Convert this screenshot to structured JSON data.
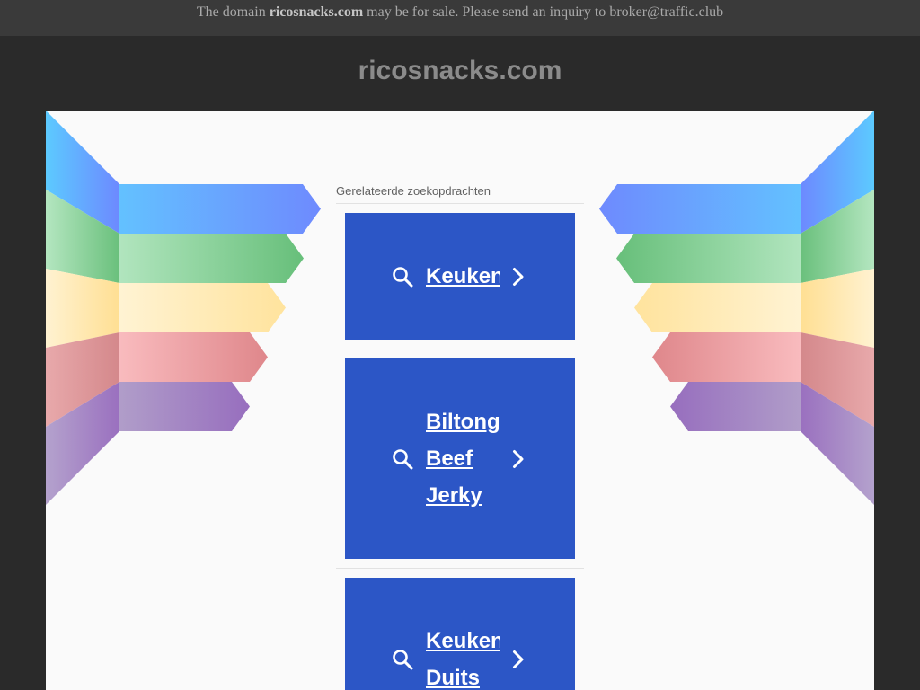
{
  "banner": {
    "prefix": "The domain",
    "domain": "ricosnacks.com",
    "message": "may be for sale. Please send an inquiry to",
    "email": "broker@traffic.club"
  },
  "header": {
    "title": "ricosnacks.com"
  },
  "related": {
    "heading": "Gerelateerde zoekopdrachten",
    "items": [
      {
        "label": "Keuken",
        "icon": "search-icon",
        "arrow_icon": "chevron-right-icon"
      },
      {
        "label": "Biltong Beef Jerky",
        "icon": "search-icon",
        "arrow_icon": "chevron-right-icon"
      },
      {
        "label": "Keuken Duits",
        "icon": "search-icon",
        "arrow_icon": "chevron-right-icon"
      }
    ]
  },
  "colors": {
    "page_background": "#2a2a2a",
    "banner_background": "#3a3a3a",
    "panel_background": "#fafafa",
    "card_background": "#2c56c6",
    "card_text": "#ffffff"
  }
}
